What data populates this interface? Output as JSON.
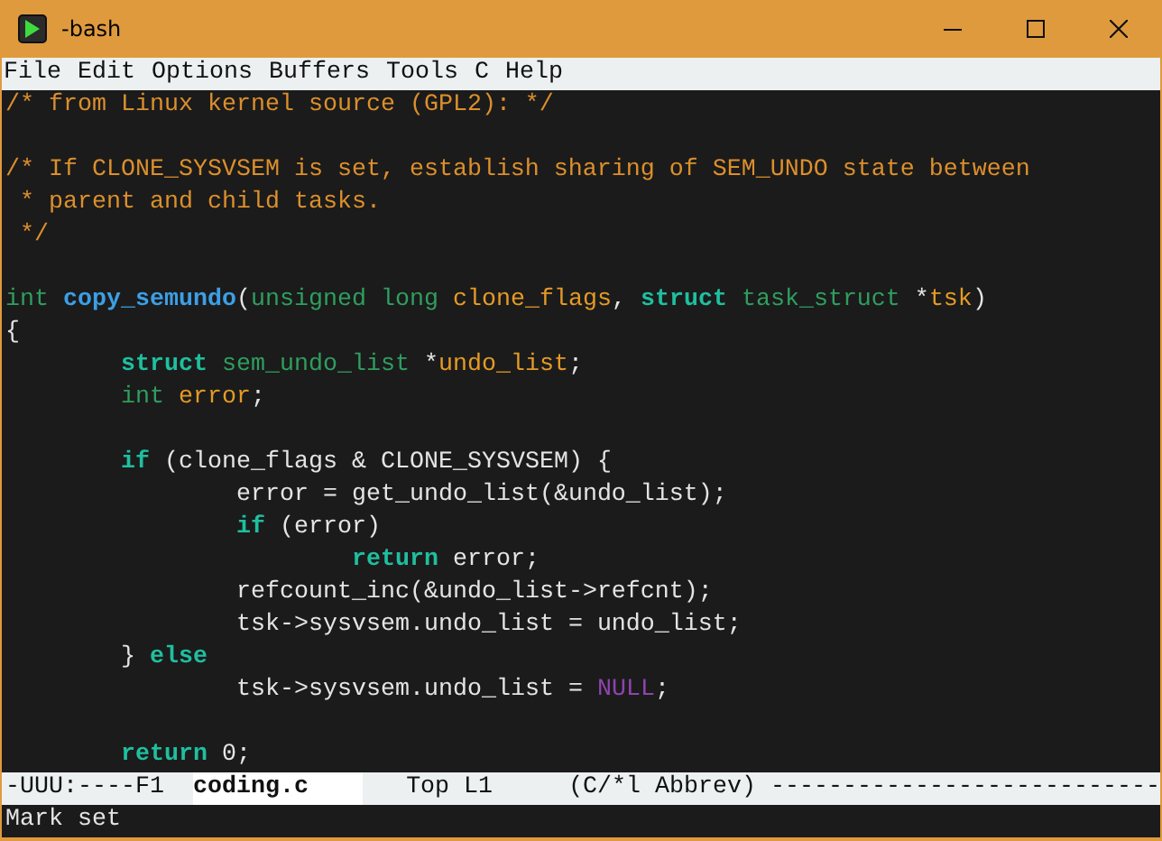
{
  "window": {
    "title": "-bash"
  },
  "menu_bar": [
    "File",
    "Edit",
    "Options",
    "Buffers",
    "Tools",
    "C",
    "Help"
  ],
  "code_lines": [
    {
      "kind": "code",
      "segments": [
        {
          "text": "/* from Linux kernel source (GPL2): */",
          "kind": "comment"
        }
      ]
    },
    {
      "kind": "blank"
    },
    {
      "kind": "code",
      "segments": [
        {
          "text": "/* If CLONE_SYSVSEM is set, establish sharing of SEM_UNDO state between",
          "kind": "comment"
        }
      ]
    },
    {
      "kind": "code",
      "segments": [
        {
          "text": " * parent and child tasks.",
          "kind": "comment"
        }
      ]
    },
    {
      "kind": "code",
      "segments": [
        {
          "text": " */",
          "kind": "comment"
        }
      ]
    },
    {
      "kind": "blank"
    },
    {
      "kind": "code",
      "segments": [
        {
          "text": "int",
          "kind": "type"
        },
        {
          "text": " copy_semundo",
          "kind": "function"
        },
        {
          "text": "(",
          "kind": "plain"
        },
        {
          "text": "unsigned long",
          "kind": "type"
        },
        {
          "text": " clone_flags",
          "kind": "variable"
        },
        {
          "text": ", ",
          "kind": "plain"
        },
        {
          "text": "struct",
          "kind": "keyword"
        },
        {
          "text": " task_struct",
          "kind": "type"
        },
        {
          "text": " *",
          "kind": "plain"
        },
        {
          "text": "tsk",
          "kind": "variable"
        },
        {
          "text": ")",
          "kind": "plain"
        }
      ]
    },
    {
      "kind": "code",
      "segments": [
        {
          "text": "{",
          "kind": "plain"
        }
      ]
    },
    {
      "kind": "code",
      "segments": [
        {
          "text": "\tstruct",
          "kind": "keyword"
        },
        {
          "text": " sem_undo_list",
          "kind": "type"
        },
        {
          "text": " *",
          "kind": "plain"
        },
        {
          "text": "undo_list",
          "kind": "variable"
        },
        {
          "text": ";",
          "kind": "plain"
        }
      ]
    },
    {
      "kind": "code",
      "segments": [
        {
          "text": "\tint",
          "kind": "type"
        },
        {
          "text": " error",
          "kind": "variable"
        },
        {
          "text": ";",
          "kind": "plain"
        }
      ]
    },
    {
      "kind": "blank"
    },
    {
      "kind": "code",
      "segments": [
        {
          "text": "\tif",
          "kind": "keyword"
        },
        {
          "text": " (clone_flags & CLONE_SYSVSEM) {",
          "kind": "plain"
        }
      ]
    },
    {
      "kind": "code",
      "segments": [
        {
          "text": "\t\terror = get_undo_list(&undo_list);",
          "kind": "plain"
        }
      ]
    },
    {
      "kind": "code",
      "segments": [
        {
          "text": "\t\tif",
          "kind": "keyword"
        },
        {
          "text": " (error)",
          "kind": "plain"
        }
      ]
    },
    {
      "kind": "code",
      "segments": [
        {
          "text": "\t\t\treturn",
          "kind": "keyword"
        },
        {
          "text": " error;",
          "kind": "plain"
        }
      ]
    },
    {
      "kind": "code",
      "segments": [
        {
          "text": "\t\trefcount_inc(&undo_list->refcnt);",
          "kind": "plain"
        }
      ]
    },
    {
      "kind": "code",
      "segments": [
        {
          "text": "\t\ttsk->sysvsem.undo_list = undo_list;",
          "kind": "plain"
        }
      ]
    },
    {
      "kind": "code",
      "segments": [
        {
          "text": "\t} ",
          "kind": "plain"
        },
        {
          "text": "else",
          "kind": "keyword"
        }
      ]
    },
    {
      "kind": "code",
      "segments": [
        {
          "text": "\t\ttsk->sysvsem.undo_list = ",
          "kind": "plain"
        },
        {
          "text": "NULL",
          "kind": "constant"
        },
        {
          "text": ";",
          "kind": "plain"
        }
      ]
    },
    {
      "kind": "blank"
    },
    {
      "kind": "code",
      "segments": [
        {
          "text": "\treturn",
          "kind": "keyword"
        },
        {
          "text": " 0;",
          "kind": "plain"
        }
      ]
    }
  ],
  "mode_line": {
    "status": "-UUU:----F1",
    "buffer": "coding.c",
    "position": "Top L1",
    "modes": "(C/*l Abbrev)",
    "fill": "---------------------------"
  },
  "minibuffer": "Mark set"
}
